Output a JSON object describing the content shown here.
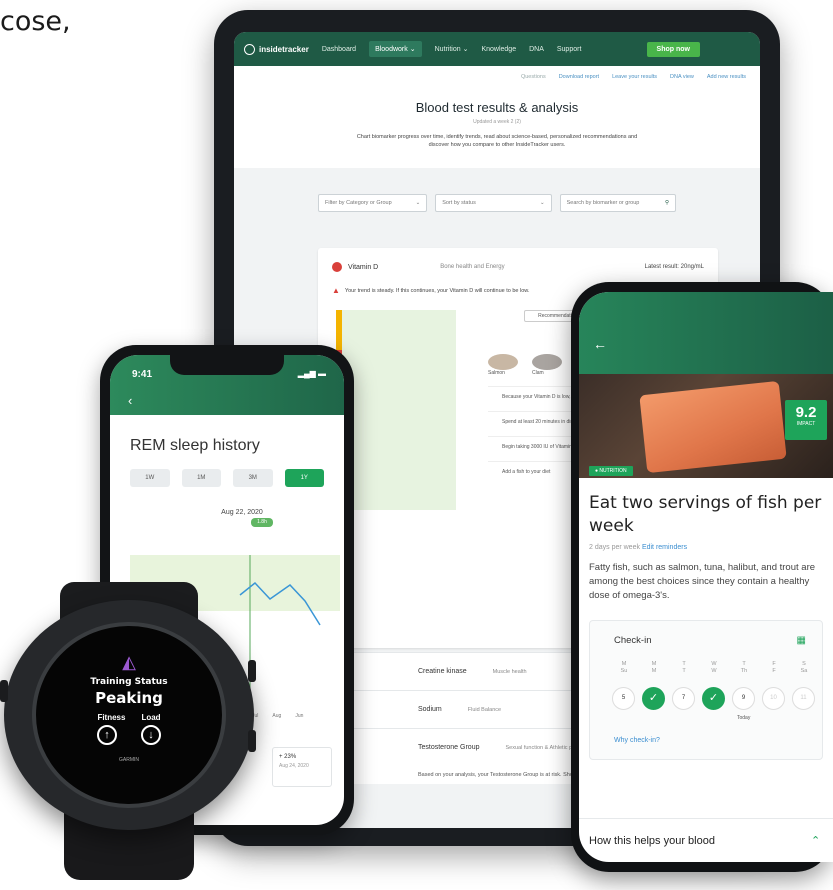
{
  "corner_text": "cose,",
  "tablet": {
    "nav": {
      "logo": "insidetracker",
      "items": [
        "Dashboard",
        "Bloodwork ⌄",
        "Nutrition ⌄",
        "Knowledge",
        "DNA",
        "Support"
      ],
      "shop": "Shop now"
    },
    "subnav": [
      "Questions",
      "Download report",
      "Leave your results",
      "DNA view",
      "Add new results"
    ],
    "title": "Blood test results & analysis",
    "subtitle": "Updated a week 2 (2)",
    "description": "Chart biomarker progress over time, identify trends, read about science-based, personalized recommendations and discover how you compare to other InsideTracker users.",
    "filters": [
      "Filter by Category or Group",
      "Sort by status",
      "Search by biomarker or group"
    ],
    "card": {
      "name": "Vitamin D",
      "category": "Bone health and Energy",
      "latest": "Latest result: 20ng/mL",
      "alert": "Your trend is steady. If this continues, your Vitamin D will continue to be low.",
      "segment": "Recommendations",
      "foods_heading": "Foods with",
      "foods": [
        "Salmon",
        "Clam"
      ],
      "tips": [
        "Because your Vitamin D is low, consider...",
        "Spend at least 20 minutes in direct sun",
        "Begin taking 3000 IU of Vitamin D supplements",
        "Add a fish to your diet",
        "Learn more about Vitamin D"
      ]
    },
    "list": [
      {
        "name": "Creatine kinase",
        "cat": "Muscle health"
      },
      {
        "name": "Sodium",
        "cat": "Fluid Balance"
      },
      {
        "name": "Testosterone Group",
        "cat": "Sexual function & Athletic performance"
      }
    ],
    "foot": "Based on your analysis, your Testosterone Group is at risk. Show more"
  },
  "phone_left": {
    "time": "9:41",
    "status": "▂▄▆ ▬",
    "back": "‹",
    "title": "REM sleep history",
    "ranges": [
      "1W",
      "1M",
      "3M",
      "1Y"
    ],
    "active_range": "1Y",
    "date": "Aug 22, 2020",
    "badge": "1.8h",
    "ticks": [
      "Jul",
      "Aug",
      "Jun"
    ],
    "stat_value": "+ 23%",
    "stat_date": "Aug 24, 2020"
  },
  "watch": {
    "status": "Training Status",
    "value": "Peaking",
    "left_label": "Fitness",
    "right_label": "Load",
    "brand": "GARMIN"
  },
  "phone_right": {
    "back": "←",
    "impact_value": "9.2",
    "impact_label": "IMPACT",
    "tag": "● NUTRITION",
    "title": "Eat two servings of fish per week",
    "meta": "2 days per week",
    "meta_link": "Edit reminders",
    "body": "Fatty fish, such as salmon, tuna, halibut, and trout are among the best choices since they contain a healthy dose of omega-3's.",
    "checkin_title": "Check-in",
    "days": [
      {
        "day": "M",
        "dow": "Su"
      },
      {
        "day": "M",
        "dow": "M"
      },
      {
        "day": "T",
        "dow": "T"
      },
      {
        "day": "W",
        "dow": "W"
      },
      {
        "day": "T",
        "dow": "Th"
      },
      {
        "day": "F",
        "dow": "F"
      },
      {
        "day": "S",
        "dow": "Sa"
      }
    ],
    "dates": [
      "5",
      "✓",
      "7",
      "✓",
      "9",
      "10",
      "11"
    ],
    "today": "Today",
    "why": "Why check-in?",
    "section": "How this helps your blood"
  },
  "colors": {
    "brand_green": "#1f5a45",
    "accent_green": "#1ea45a",
    "alert_red": "#d9403a"
  }
}
